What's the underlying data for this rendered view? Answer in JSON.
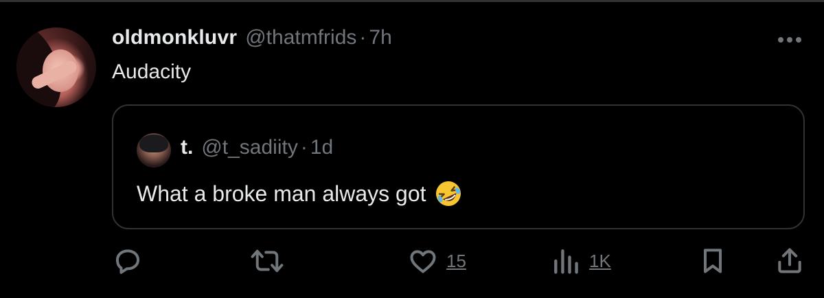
{
  "tweet": {
    "display_name": "oldmonkluvr",
    "handle": "@thatmfrids",
    "separator": "·",
    "time": "7h",
    "text": "Audacity",
    "avatar_icon": "user-avatar-photo",
    "more_icon": "more-dots-icon"
  },
  "quoted": {
    "display_name": "t.",
    "handle": "@t_sadiity",
    "separator": "·",
    "time": "1d",
    "text": "What a broke man always got",
    "emoji": "rolling-on-floor-laughing-emoji"
  },
  "actions": {
    "reply": {
      "icon": "reply-icon"
    },
    "retweet": {
      "icon": "retweet-icon"
    },
    "like": {
      "icon": "heart-icon",
      "count": "15"
    },
    "views": {
      "icon": "views-icon",
      "count": "1K"
    },
    "bookmark": {
      "icon": "bookmark-icon"
    },
    "share": {
      "icon": "share-icon"
    }
  },
  "colors": {
    "background": "#000000",
    "text_primary": "#e7e9ea",
    "text_secondary": "#71767b",
    "border": "#2f3336"
  }
}
